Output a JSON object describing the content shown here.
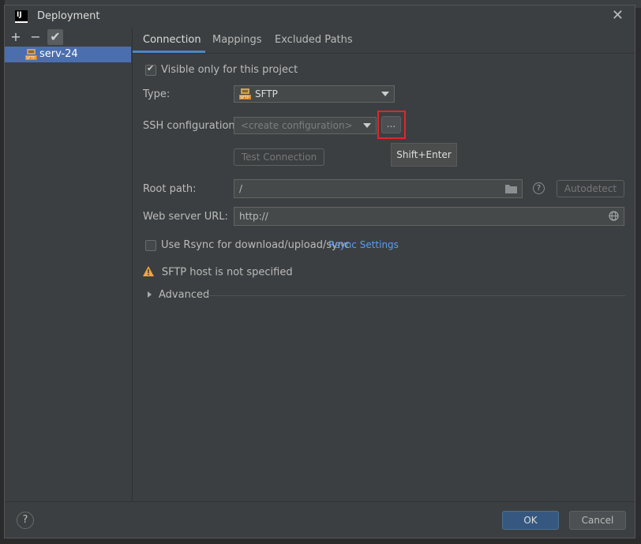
{
  "window": {
    "title": "Deployment",
    "app_icon_text": "IJ"
  },
  "sidebar": {
    "toolbar": {
      "add_icon": "plus-icon",
      "remove_icon": "minus-icon",
      "check_icon": "check-icon"
    },
    "items": [
      {
        "label": "serv-24",
        "icon": "sftp-server-icon",
        "selected": true
      }
    ]
  },
  "tabs": [
    {
      "label": "Connection",
      "active": true
    },
    {
      "label": "Mappings",
      "active": false
    },
    {
      "label": "Excluded Paths",
      "active": false
    }
  ],
  "connection": {
    "visible_only_label": "Visible only for this project",
    "visible_only_checked": true,
    "type_label": "Type:",
    "type_value": "SFTP",
    "ssh_label": "SSH configuration:",
    "ssh_placeholder": "<create configuration>",
    "browse_button": "...",
    "tooltip": "Shift+Enter",
    "test_connection": "Test Connection",
    "root_path_label": "Root path:",
    "root_path_value": "/",
    "autodetect": "Autodetect",
    "web_url_label": "Web server URL:",
    "web_url_value": "http://",
    "rsync_label": "Use Rsync for download/upload/sync",
    "rsync_checked": false,
    "rsync_settings": "Rsync Settings",
    "warning": "SFTP host is not specified",
    "advanced": "Advanced"
  },
  "footer": {
    "help": "?",
    "ok": "OK",
    "cancel": "Cancel"
  },
  "colors": {
    "accent": "#4a88c7",
    "selection": "#4b6eaf",
    "highlight_border": "#e0262a",
    "warning": "#f0a732",
    "link": "#589df6"
  }
}
